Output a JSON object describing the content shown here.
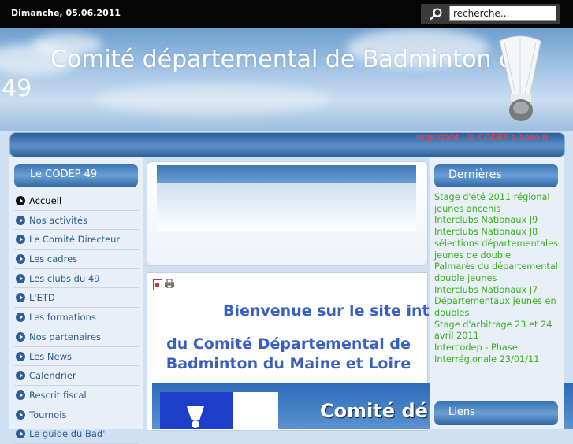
{
  "topbar": {
    "date": "Dimanche, 05.06.2011",
    "search_placeholder": "recherche..."
  },
  "header": {
    "title_line1": "Comité départemental de Badminton du",
    "title_line2": "49"
  },
  "navbar": {
    "important": "Important : le CODEP a besoin"
  },
  "sidebar": {
    "heading": "Le CODEP 49",
    "items": [
      {
        "label": "Accueil"
      },
      {
        "label": "Nos activités"
      },
      {
        "label": "Le Comité Directeur"
      },
      {
        "label": "Les cadres"
      },
      {
        "label": "Les clubs du 49"
      },
      {
        "label": "L'ETD"
      },
      {
        "label": "Les formations"
      },
      {
        "label": "Nos partenaires"
      },
      {
        "label": "Les News"
      },
      {
        "label": "Calendrier"
      },
      {
        "label": "Rescrit fiscal"
      },
      {
        "label": "Tournois"
      },
      {
        "label": "Le guide du Bad'"
      }
    ]
  },
  "main": {
    "welcome_line1": "Bienvenue sur le site internet",
    "welcome_line2": "du Comité Départemental de Badminton du Maine et Loire",
    "banner_text": "Comité dépar"
  },
  "right": {
    "heading": "Dernières",
    "news": [
      "Stage d'été 2011 régional jeunes ancenis",
      "Interclubs Nationaux J9",
      "Interclubs Nationaux J8",
      "sélections départementales jeunes de double",
      "Palmarès du départemental double jeunes",
      "Interclubs Nationaux J7",
      "Départementaux jeunes en doubles",
      "Stage d'arbitrage 23 et 24 avril 2011",
      "Intercodep - Phase Interrégionale 23/01/11"
    ],
    "links_heading": "Liens"
  },
  "colors": {
    "accent_blue": "#3a74b5",
    "news_green": "#39b01f",
    "welcome_blue": "#3a5fc2",
    "important_red": "#e44444"
  }
}
